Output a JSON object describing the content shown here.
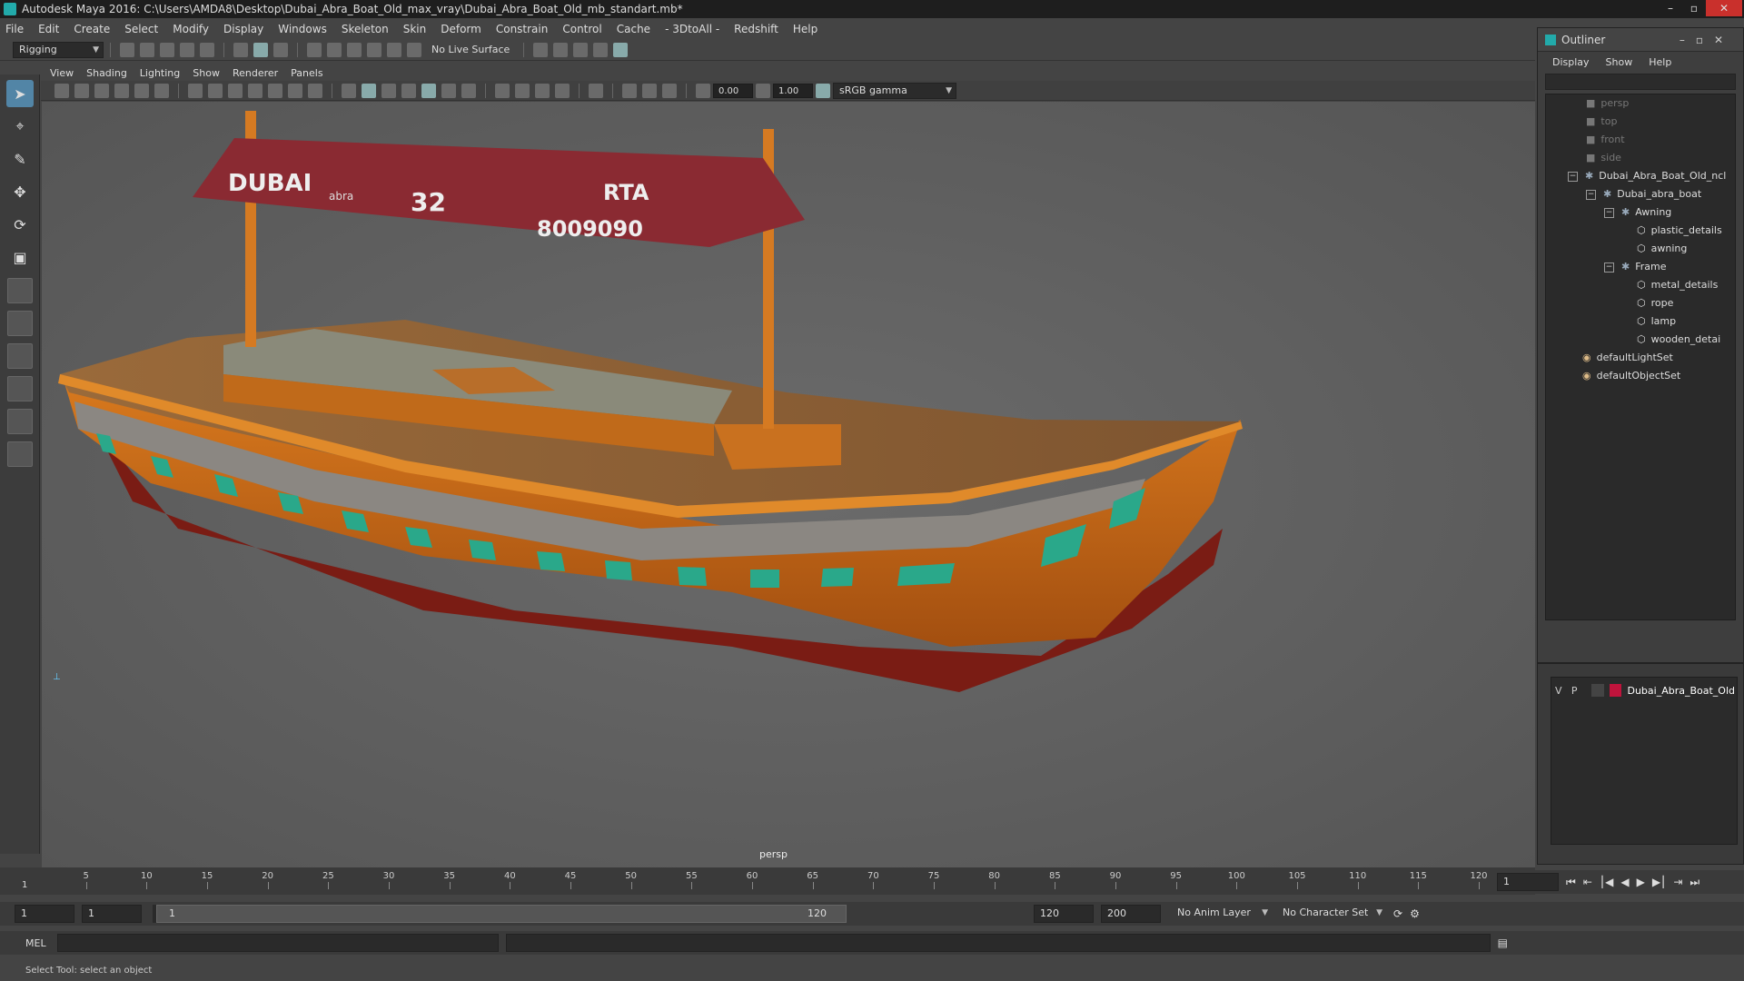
{
  "window": {
    "title": "Autodesk Maya 2016: C:\\Users\\AMDA8\\Desktop\\Dubai_Abra_Boat_Old_max_vray\\Dubai_Abra_Boat_Old_mb_standart.mb*"
  },
  "menu": [
    "File",
    "Edit",
    "Create",
    "Select",
    "Modify",
    "Display",
    "Windows",
    "Skeleton",
    "Skin",
    "Deform",
    "Constrain",
    "Control",
    "Cache",
    "- 3DtoAll -",
    "Redshift",
    "Help"
  ],
  "toolbar": {
    "mode": "Rigging",
    "live_surface": "No Live Surface"
  },
  "viewport_menu": [
    "View",
    "Shading",
    "Lighting",
    "Show",
    "Renderer",
    "Panels"
  ],
  "viewport_toolbar": {
    "exposure": "0.00",
    "gamma": "1.00",
    "color_space": "sRGB gamma"
  },
  "viewport": {
    "camera_label": "persp"
  },
  "boat": {
    "brand": "DUBAI",
    "brand_sub": "abra",
    "number": "32",
    "operator": "RTA",
    "phone": "8009090"
  },
  "timeline": {
    "ticks": [
      "5",
      "10",
      "15",
      "20",
      "25",
      "30",
      "35",
      "40",
      "45",
      "50",
      "55",
      "60",
      "65",
      "70",
      "75",
      "80",
      "85",
      "90",
      "95",
      "100",
      "105",
      "110",
      "115",
      "120"
    ],
    "current_frame": "1",
    "start_marker": "1"
  },
  "range": {
    "start": "1",
    "start2": "1",
    "slider_start": "1",
    "slider_end": "120",
    "end": "120",
    "anim_end": "200",
    "anim_layer": "No Anim Layer",
    "char_set": "No Character Set"
  },
  "cmd": {
    "label": "MEL"
  },
  "help": "Select Tool: select an object",
  "outliner": {
    "title": "Outliner",
    "menu": [
      "Display",
      "Show",
      "Help"
    ],
    "items": [
      {
        "label": "persp",
        "dim": true
      },
      {
        "label": "top",
        "dim": true
      },
      {
        "label": "front",
        "dim": true
      },
      {
        "label": "side",
        "dim": true
      },
      {
        "label": "Dubai_Abra_Boat_Old_ncl"
      },
      {
        "label": "Dubai_abra_boat"
      },
      {
        "label": "Awning"
      },
      {
        "label": "plastic_details"
      },
      {
        "label": "awning"
      },
      {
        "label": "Frame"
      },
      {
        "label": "metal_details"
      },
      {
        "label": "rope"
      },
      {
        "label": "lamp"
      },
      {
        "label": "wooden_detai"
      },
      {
        "label": "defaultLightSet"
      },
      {
        "label": "defaultObjectSet"
      }
    ]
  },
  "layers": {
    "v": "V",
    "p": "P",
    "name": "Dubai_Abra_Boat_Old",
    "color": "#c0143c"
  }
}
